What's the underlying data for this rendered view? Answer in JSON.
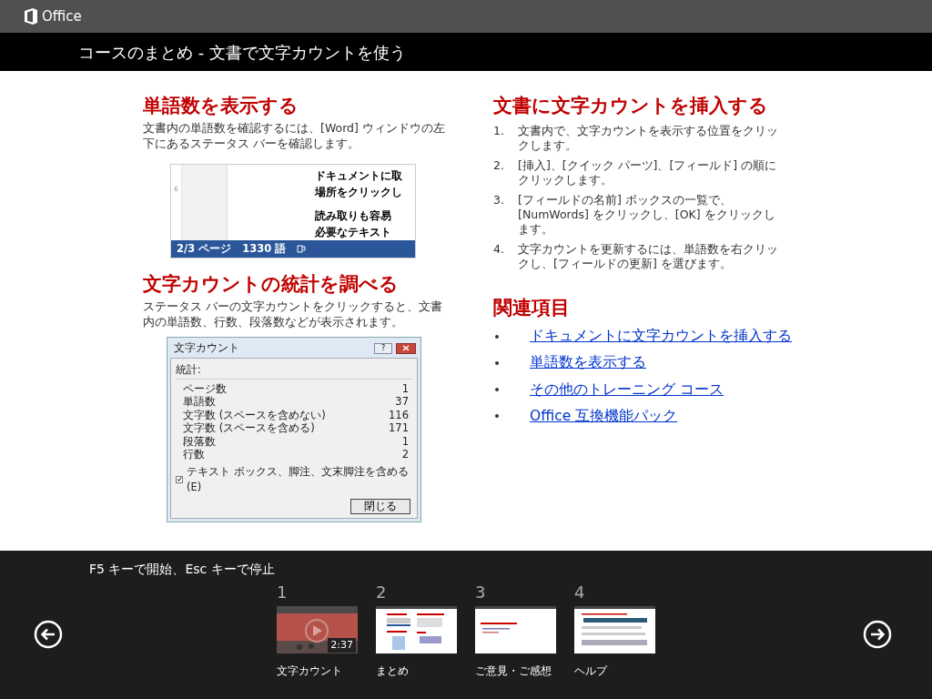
{
  "app": {
    "name": "Office"
  },
  "title": "コースのまとめ - 文書で文字カウントを使う",
  "left_sections": [
    {
      "heading": "単語数を表示する",
      "text": "文書内の単語数を確認するには、[Word] ウィンドウの左下にあるステータス バーを確認します。",
      "figure": {
        "kind": "statusbar",
        "doc_lines": [
          "ドキュメントに取",
          "場所をクリックし",
          "読み取りも容易",
          "必要なテキスト"
        ],
        "ruler_mark": "6",
        "page": "2/3 ページ",
        "words": "1330 語"
      }
    },
    {
      "heading": "文字カウントの統計を調べる",
      "text": "ステータス バーの文字カウントをクリックすると、文書内の単語数、行数、段落数などが表示されます。",
      "figure": {
        "kind": "dialog",
        "title": "文字カウント",
        "help": "?",
        "group": "統計:",
        "rows": [
          {
            "name": "ページ数",
            "value": "1"
          },
          {
            "name": "単語数",
            "value": "37"
          },
          {
            "name": "文字数 (スペースを含めない)",
            "value": "116"
          },
          {
            "name": "文字数 (スペースを含める)",
            "value": "171"
          },
          {
            "name": "段落数",
            "value": "1"
          },
          {
            "name": "行数",
            "value": "2"
          }
        ],
        "checkbox": {
          "label": "テキスト ボックス、脚注、文末脚注を含める(E)",
          "checked": true
        },
        "button": "閉じる"
      }
    }
  ],
  "insert": {
    "heading": "文書に文字カウントを挿入する",
    "steps": [
      {
        "number": "1.",
        "text": "文書内で、文字カウントを表示する位置をクリックします。"
      },
      {
        "number": "2.",
        "text": "[挿入]、[クイック パーツ]、[フィールド] の順にクリックします。"
      },
      {
        "number": "3.",
        "text": "[フィールドの名前] ボックスの一覧で、[NumWords] をクリックし、[OK] をクリックします。"
      },
      {
        "number": "4.",
        "text": "文字カウントを更新するには、単語数を右クリックし、[フィールドの更新] を選びます。"
      }
    ]
  },
  "related": {
    "heading": "関連項目",
    "links": [
      "ドキュメントに文字カウントを挿入する",
      "単語数を表示する",
      "その他のトレーニング コース",
      "Office 互換機能パック"
    ]
  },
  "footer": {
    "hint": "F5 キーで開始、Esc キーで停止",
    "slides": [
      {
        "number": "1",
        "label": "文字カウント",
        "kind": "video",
        "duration": "2:37"
      },
      {
        "number": "2",
        "label": "まとめ",
        "kind": "summary"
      },
      {
        "number": "3",
        "label": "ご意見・ご感想",
        "kind": "feedback"
      },
      {
        "number": "4",
        "label": "ヘルプ",
        "kind": "help"
      }
    ]
  }
}
